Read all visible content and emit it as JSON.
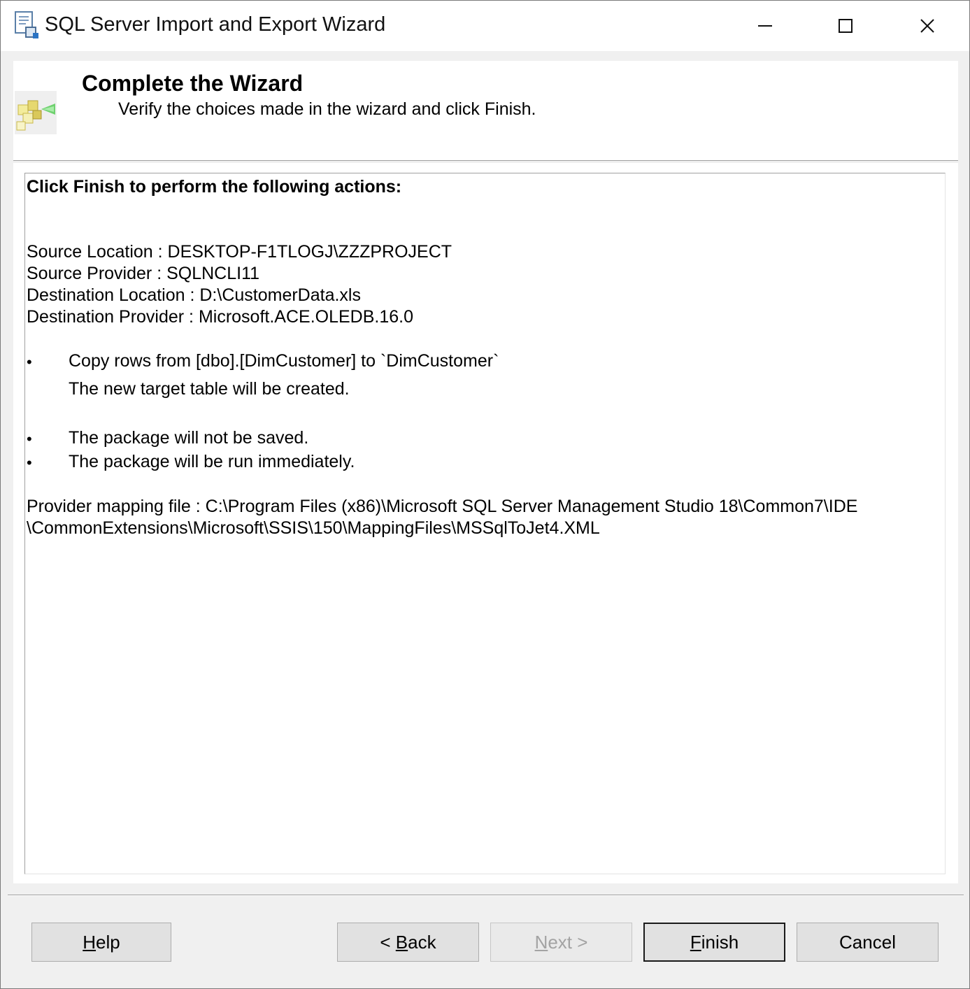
{
  "window": {
    "title": "SQL Server Import and Export Wizard",
    "controls": [
      "minimize",
      "maximize",
      "close"
    ]
  },
  "header": {
    "title": "Complete the Wizard",
    "subtitle": "Verify the choices made in the wizard and click Finish."
  },
  "summary": {
    "heading": "Click Finish to perform the following actions:",
    "source_location": "Source Location : DESKTOP-F1TLOGJ\\ZZZPROJECT",
    "source_provider": "Source Provider : SQLNCLI11",
    "destination_location": "Destination Location : D:\\CustomerData.xls",
    "destination_provider": "Destination Provider : Microsoft.ACE.OLEDB.16.0",
    "bullet_char": "•",
    "copy_rows": "Copy rows from [dbo].[DimCustomer] to `DimCustomer`",
    "new_table_note": "The new target table will be created.",
    "package_not_saved": "The package will not be saved.",
    "package_run": "The package will be run immediately.",
    "mapping_line1": "Provider mapping file : C:\\Program Files (x86)\\Microsoft SQL Server Management Studio 18\\Common7\\IDE",
    "mapping_line2": "\\CommonExtensions\\Microsoft\\SSIS\\150\\MappingFiles\\MSSqlToJet4.XML"
  },
  "buttons": {
    "help": {
      "pre": "",
      "key": "H",
      "post": "elp"
    },
    "back": {
      "pre": "< ",
      "key": "B",
      "post": "ack"
    },
    "next": {
      "pre": "",
      "key": "N",
      "post": "ext >"
    },
    "finish": {
      "pre": "",
      "key": "F",
      "post": "inish"
    },
    "cancel": {
      "label": "Cancel"
    }
  }
}
